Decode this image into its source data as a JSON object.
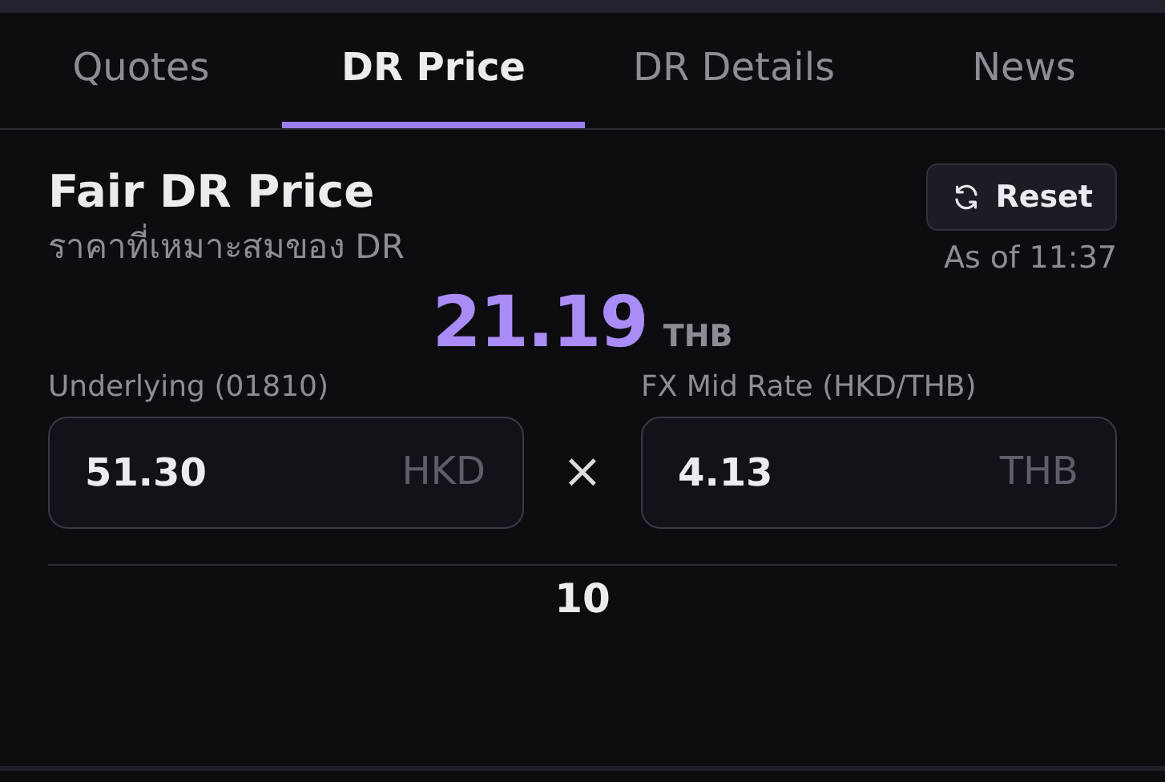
{
  "tabs": [
    {
      "label": "Quotes",
      "selected": false
    },
    {
      "label": "DR Price",
      "selected": true
    },
    {
      "label": "DR Details",
      "selected": false
    },
    {
      "label": "News",
      "selected": false
    }
  ],
  "header": {
    "title": "Fair DR Price",
    "subtitle": "ราคาที่เหมาะสมของ DR",
    "reset_button": "Reset",
    "timestamp": "As of 11:37"
  },
  "result": {
    "value": "21.19",
    "unit": "THB"
  },
  "inputs": [
    {
      "label": "Underlying (01810)",
      "value": "51.30",
      "unit": "HKD"
    },
    {
      "label": "FX Mid Rate (HKD/THB)",
      "value": "4.13",
      "unit": "THB"
    }
  ],
  "operator": "×",
  "divisor": "10"
}
